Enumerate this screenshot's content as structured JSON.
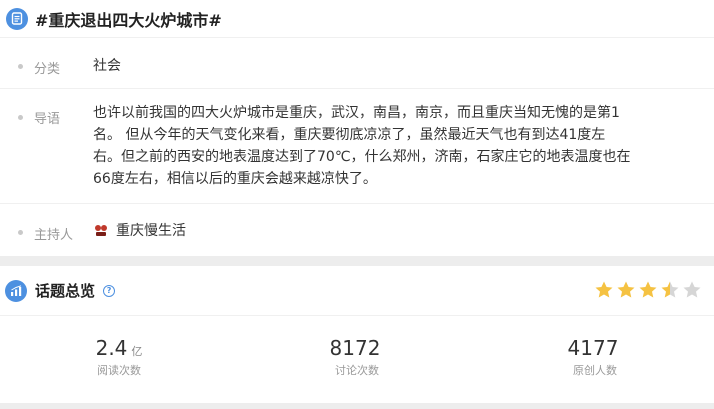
{
  "topic": {
    "title": "#重庆退出四大火炉城市#",
    "category_label": "分类",
    "category_value": "社会",
    "intro_label": "导语",
    "intro_lines": [
      "也许以前我国的四大火炉城市是重庆，武汉，南昌，南京，而且重庆当知无愧的是第1",
      "名。 但从今年的天气变化来看，重庆要彻底凉凉了，虽然最近天气也有到达41度左",
      "右。但之前的西安的地表温度达到了70℃，什么郑州，济南，石家庄它的地表温度也在",
      "66度左右，相信以后的重庆会越来越凉快了。"
    ],
    "host_label": "主持人",
    "host_name": "重庆慢生活"
  },
  "overview": {
    "title": "话题总览",
    "help_glyph": "?",
    "rating": 3.5,
    "rating_max": 5,
    "stats": [
      {
        "number": "2.4",
        "unit": "亿",
        "label": "阅读次数"
      },
      {
        "number": "8172",
        "unit": "",
        "label": "讨论次数"
      },
      {
        "number": "4177",
        "unit": "",
        "label": "原创人数"
      }
    ]
  },
  "colors": {
    "accent": "#4d90e0",
    "star": "#f5c242",
    "star_empty": "#d6d6d6"
  },
  "icons": [
    "document-icon",
    "chart-icon",
    "help-icon",
    "star-icon"
  ]
}
